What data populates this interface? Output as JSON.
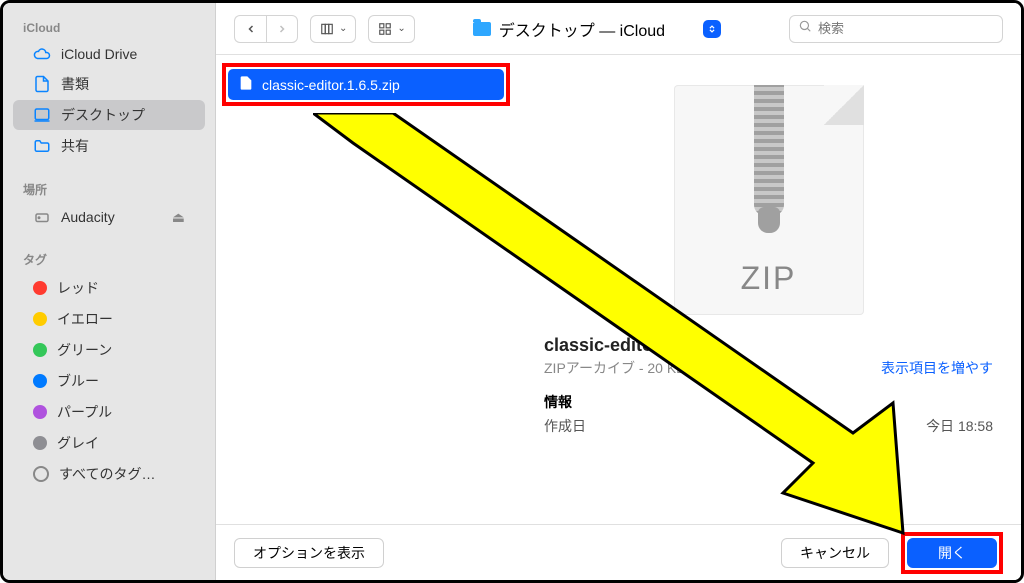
{
  "sidebar": {
    "sections": [
      {
        "header": "iCloud",
        "items": [
          {
            "icon": "cloud",
            "label": "iCloud Drive"
          },
          {
            "icon": "doc",
            "label": "書類"
          },
          {
            "icon": "desktop",
            "label": "デスクトップ",
            "selected": true
          },
          {
            "icon": "folder",
            "label": "共有"
          }
        ]
      },
      {
        "header": "場所",
        "items": [
          {
            "icon": "disk",
            "label": "Audacity",
            "eject": true
          }
        ]
      },
      {
        "header": "タグ",
        "items": [
          {
            "icon": "tag",
            "color": "#ff3b30",
            "label": "レッド"
          },
          {
            "icon": "tag",
            "color": "#ffcc00",
            "label": "イエロー"
          },
          {
            "icon": "tag",
            "color": "#34c759",
            "label": "グリーン"
          },
          {
            "icon": "tag",
            "color": "#007aff",
            "label": "ブルー"
          },
          {
            "icon": "tag",
            "color": "#af52de",
            "label": "パープル"
          },
          {
            "icon": "tag",
            "color": "#8e8e93",
            "label": "グレイ"
          },
          {
            "icon": "all-tags",
            "label": "すべてのタグ…"
          }
        ]
      }
    ]
  },
  "toolbar": {
    "location": "デスクトップ — iCloud",
    "search_placeholder": "検索"
  },
  "files": [
    {
      "name": "classic-editor.1.6.5.zip",
      "selected": true,
      "highlighted": true
    }
  ],
  "preview": {
    "zip_text": "ZIP",
    "name": "classic-editor.1.6",
    "subtitle": "ZIPアーカイブ - 20 KB",
    "info_label": "情報",
    "created_label": "作成日",
    "created_value": "今日 18:58",
    "more_label": "表示項目を増やす"
  },
  "footer": {
    "options": "オプションを表示",
    "cancel": "キャンセル",
    "open": "開く"
  },
  "colors": {
    "accent": "#0a60ff",
    "highlight": "#ff0000",
    "arrow": "#ffff00"
  }
}
